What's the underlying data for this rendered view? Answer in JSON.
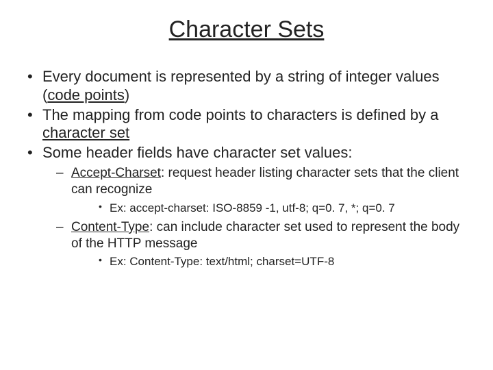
{
  "title": "Character Sets",
  "b1a": "Every document is represented by a string of integer values (",
  "b1b": "code points",
  "b1c": ")",
  "b2a": "The mapping from code points to characters is defined by a ",
  "b2b": "character set",
  "b3": "Some header fields have character set values:",
  "s1a": "Accept-Charset",
  "s1b": ": request header listing character sets that the client can recognize",
  "s1ex": "Ex: accept-charset: ISO-8859 -1, utf-8; q=0. 7, *; q=0. 7",
  "s2a": "Content-Type",
  "s2b": ": can include character set used to represent the body of the HTTP message",
  "s2ex": "Ex: Content-Type: text/html; charset=UTF-8"
}
